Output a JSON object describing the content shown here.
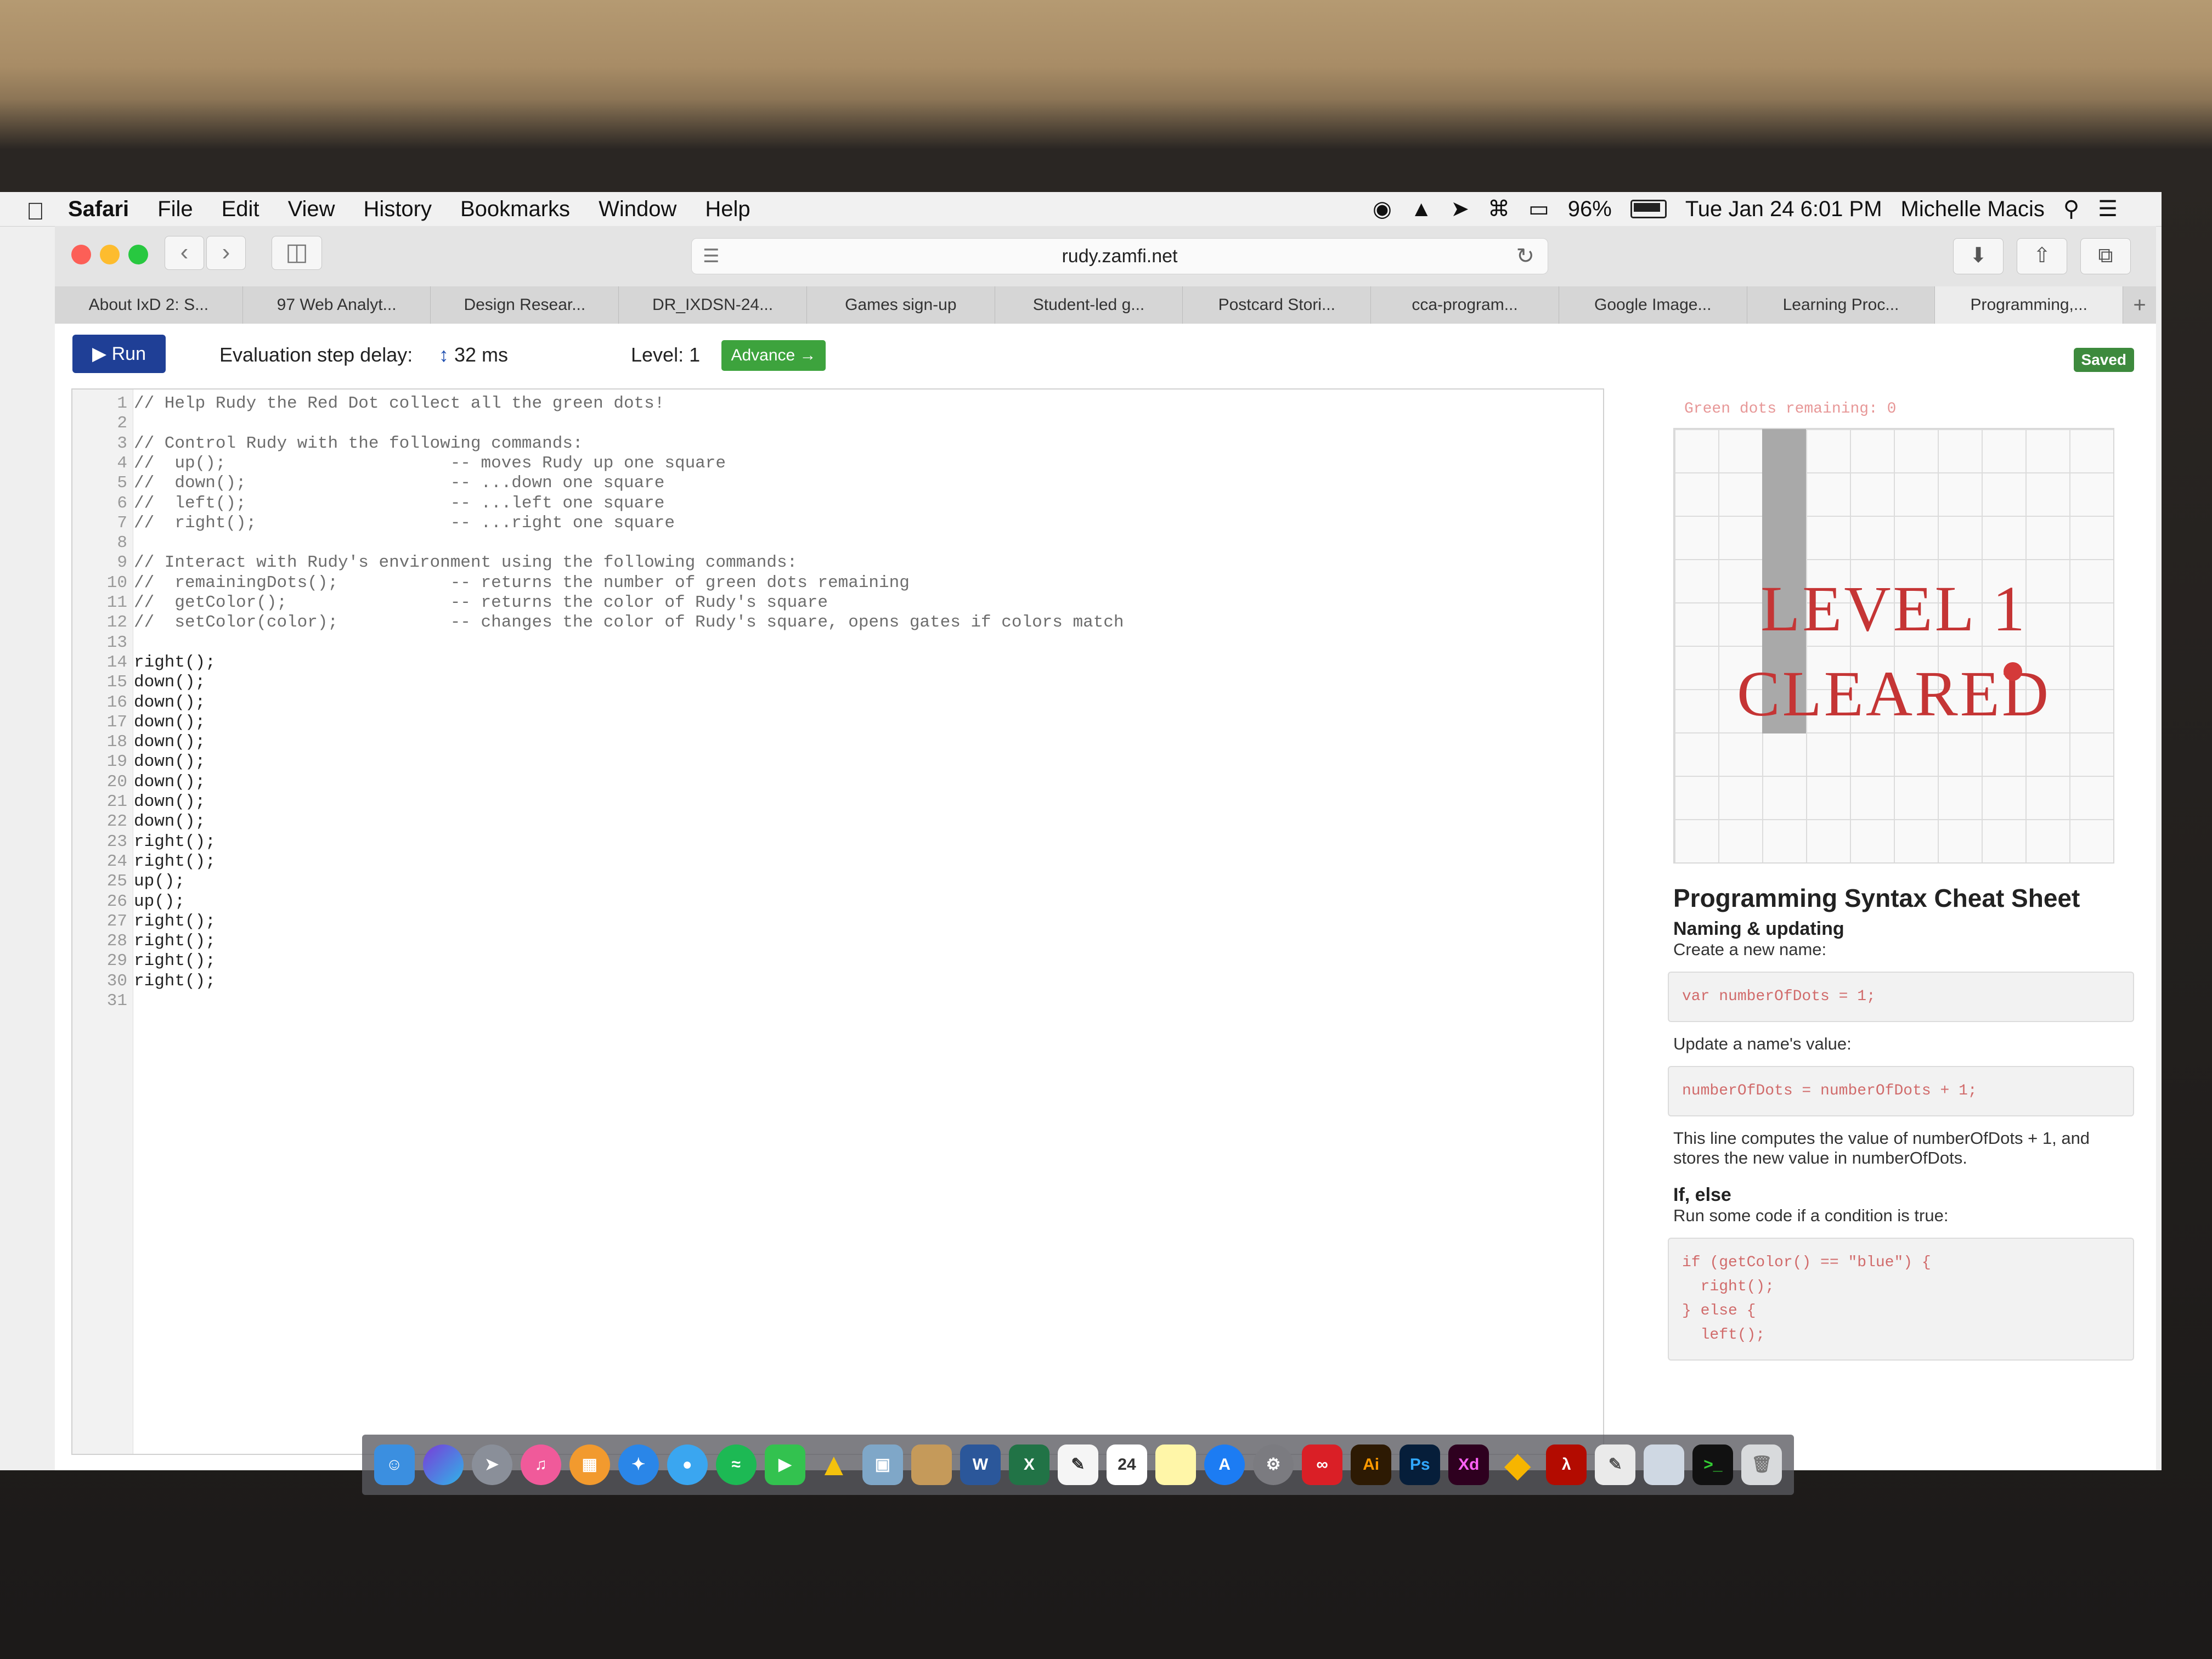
{
  "menubar": {
    "app": "Safari",
    "items": [
      "File",
      "Edit",
      "View",
      "History",
      "Bookmarks",
      "Window",
      "Help"
    ],
    "battery": "96%",
    "datetime": "Tue Jan 24  6:01 PM",
    "user": "Michelle Macis"
  },
  "browser": {
    "url": "rudy.zamfi.net",
    "tabs": [
      "About IxD 2: S...",
      "97 Web Analyt...",
      "Design Resear...",
      "DR_IXDSN-24...",
      "Games sign-up",
      "Student-led g...",
      "Postcard Stori...",
      "cca-program...",
      "Google Image...",
      "Learning Proc...",
      "Programming,..."
    ],
    "active_tab": 10
  },
  "page": {
    "run_label": "Run",
    "delay_label": "Evaluation step delay:",
    "delay_value": "32 ms",
    "level_label": "Level: 1",
    "advance_label": "Advance →",
    "saved_label": "Saved"
  },
  "editor": {
    "lines": [
      "// Help Rudy the Red Dot collect all the green dots!",
      "",
      "// Control Rudy with the following commands:",
      "//  up();                      -- moves Rudy up one square",
      "//  down();                    -- ...down one square",
      "//  left();                    -- ...left one square",
      "//  right();                   -- ...right one square",
      "",
      "// Interact with Rudy's environment using the following commands:",
      "//  remainingDots();           -- returns the number of green dots remaining",
      "//  getColor();                -- returns the color of Rudy's square",
      "//  setColor(color);           -- changes the color of Rudy's square, opens gates if colors match",
      "",
      "right();",
      "down();",
      "down();",
      "down();",
      "down();",
      "down();",
      "down();",
      "down();",
      "down();",
      "right();",
      "right();",
      "up();",
      "up();",
      "right();",
      "right();",
      "right();",
      "right();",
      ""
    ]
  },
  "game": {
    "remaining_label": "Green dots remaining: 0",
    "cleared_line1": "LEVEL 1",
    "cleared_line2": "CLEARED"
  },
  "cheatsheet": {
    "title": "Programming Syntax Cheat Sheet",
    "naming_heading": "Naming & updating",
    "create_label": "Create a new name:",
    "create_code": "var numberOfDots = 1;",
    "update_label": "Update a name's value:",
    "update_code": "numberOfDots = numberOfDots + 1;",
    "explain": "This line computes the value of numberOfDots + 1, and stores the new value in numberOfDots.",
    "ifelse_heading": "If, else",
    "ifelse_label": "Run some code if a condition is true:",
    "ifelse_code": "if (getColor() == \"blue\") {\n  right();\n} else {\n  left();"
  },
  "colors": {
    "run_button": "#1f3f96",
    "advance_button": "#3da33d",
    "cleared_text": "#c53535",
    "code_snippet": "#d16b6b"
  },
  "dock": {
    "icons": [
      "finder-icon",
      "siri-icon",
      "launchpad-icon",
      "itunes-icon",
      "ibooks-icon",
      "safari-icon",
      "messages-icon",
      "spotify-icon",
      "facetime-icon",
      "google-drive-icon",
      "preview-icon",
      "notes-icon",
      "word-icon",
      "excel-icon",
      "textedit-icon",
      "calendar-icon",
      "stickies-icon",
      "app-store-icon",
      "system-preferences-icon",
      "creative-cloud-icon",
      "illustrator-icon",
      "photoshop-icon",
      "xd-icon",
      "sketch-icon",
      "acrobat-icon",
      "script-editor-icon",
      "folder-icon",
      "terminal-icon",
      "trash-icon"
    ],
    "calendar_day": "24",
    "illustrator_label": "Ai",
    "photoshop_label": "Ps",
    "xd_label": "Xd",
    "word_label": "W",
    "excel_label": "X"
  }
}
